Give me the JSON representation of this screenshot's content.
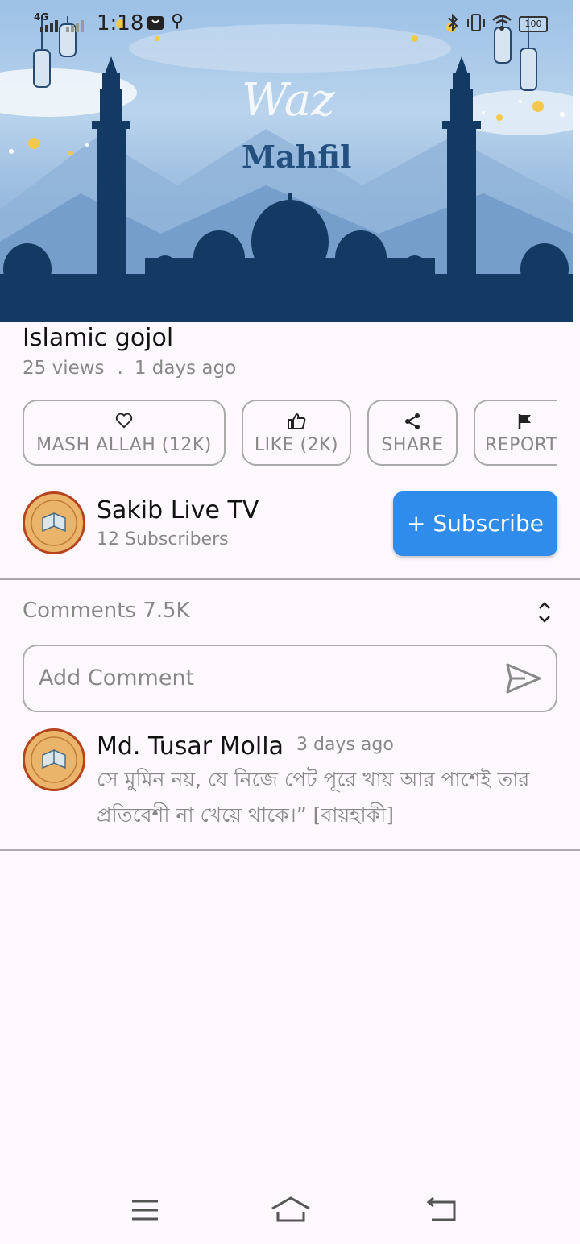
{
  "status_bar": {
    "network": "4G",
    "time": "1:18",
    "battery": "100"
  },
  "video": {
    "thumbnail_text_script": "Waz",
    "thumbnail_text_bold": "Mahfil",
    "title": "Islamic gojol",
    "views": "25 views",
    "separator": ".",
    "age": "1 days ago"
  },
  "actions": [
    {
      "label": "MASH ALLAH (12K)",
      "icon": "heart-icon"
    },
    {
      "label": "LIKE (2K)",
      "icon": "thumbs-up-icon"
    },
    {
      "label": "SHARE",
      "icon": "share-icon"
    },
    {
      "label": "REPORT",
      "icon": "flag-icon"
    }
  ],
  "channel": {
    "name": "Sakib Live TV",
    "subscribers": "12 Subscribers",
    "subscribe_label": "+ Subscribe"
  },
  "comments": {
    "header": "Comments 7.5K",
    "input_placeholder": "Add Comment",
    "items": [
      {
        "author": "Md. Tusar Molla",
        "time": "3 days ago",
        "text": "সে মুমিন নয়, যে নিজে পেট পূরে খায় আর পাশেই তার প্রতিবেশী না খেয়ে থাকে।” [বায়হাকী]"
      }
    ]
  },
  "colors": {
    "accent": "#2f8ceb",
    "hero_silhouette": "#133a62",
    "background": "#fdf8fd"
  }
}
